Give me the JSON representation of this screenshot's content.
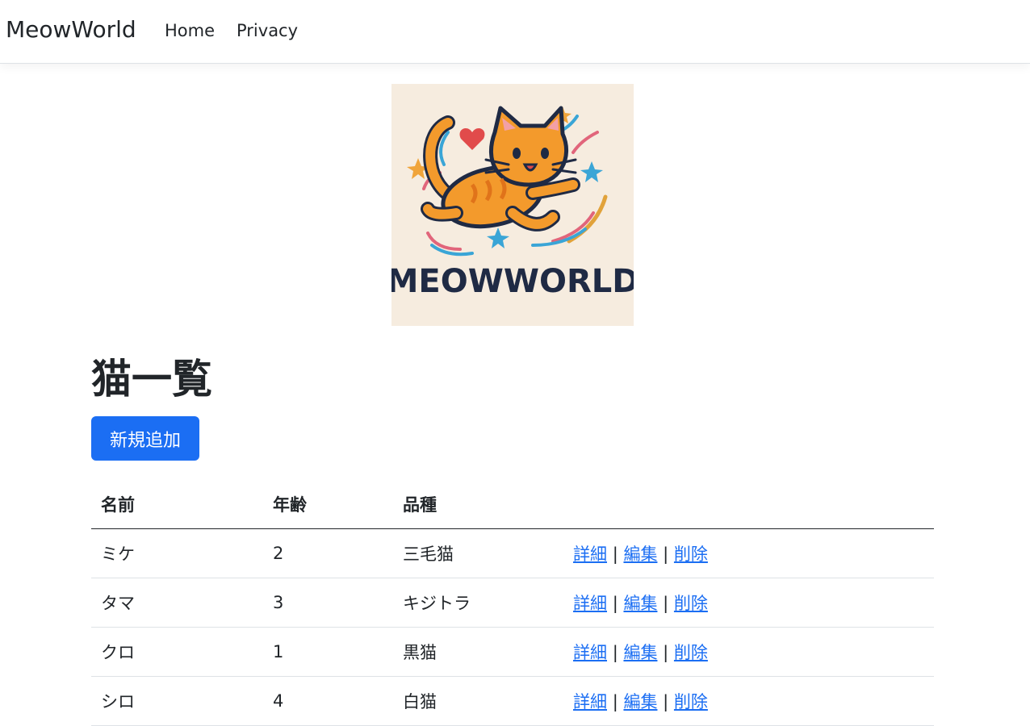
{
  "navbar": {
    "brand": "MeowWorld",
    "links": [
      {
        "label": "Home"
      },
      {
        "label": "Privacy"
      }
    ]
  },
  "logo": {
    "text": "MEOWWORLD",
    "background": "#f6ecdf"
  },
  "page": {
    "title": "猫一覧",
    "add_button": "新規追加"
  },
  "table": {
    "headers": [
      "名前",
      "年齢",
      "品種",
      ""
    ],
    "rows": [
      {
        "name": "ミケ",
        "age": "2",
        "breed": "三毛猫"
      },
      {
        "name": "タマ",
        "age": "3",
        "breed": "キジトラ"
      },
      {
        "name": "クロ",
        "age": "1",
        "breed": "黒猫"
      },
      {
        "name": "シロ",
        "age": "4",
        "breed": "白猫"
      }
    ],
    "actions": {
      "details": "詳細",
      "edit": "編集",
      "delete": "削除",
      "separator": "|"
    }
  },
  "colors": {
    "primary": "#1b6ef3",
    "text": "#212529",
    "border": "#dee2e6"
  }
}
